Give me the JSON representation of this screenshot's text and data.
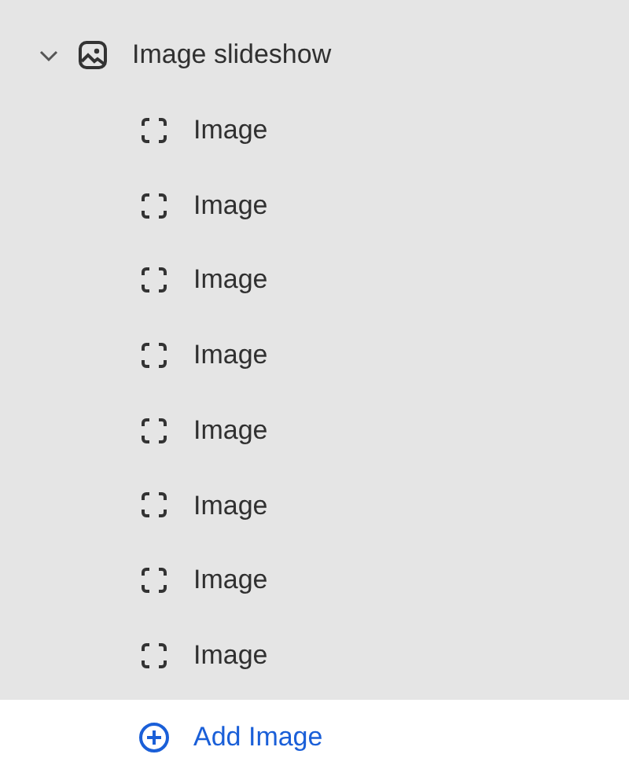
{
  "section": {
    "label": "Image slideshow",
    "expanded": true,
    "children": [
      {
        "label": "Image"
      },
      {
        "label": "Image"
      },
      {
        "label": "Image"
      },
      {
        "label": "Image"
      },
      {
        "label": "Image"
      },
      {
        "label": "Image"
      },
      {
        "label": "Image"
      },
      {
        "label": "Image"
      }
    ]
  },
  "add_button": {
    "label": "Add Image"
  }
}
